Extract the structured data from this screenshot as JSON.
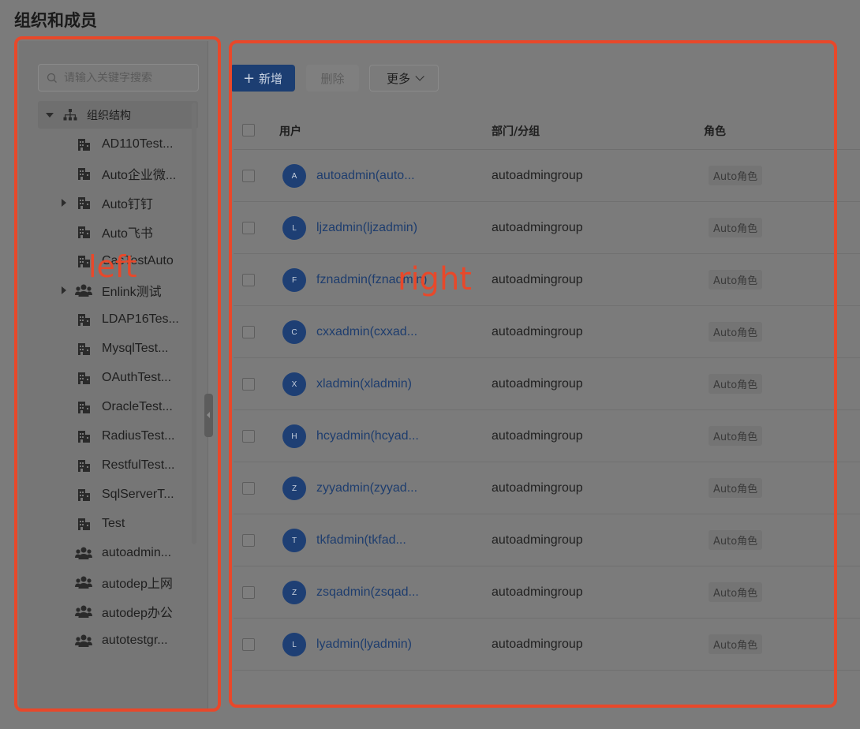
{
  "page": {
    "title": "组织和成员"
  },
  "sidebar": {
    "search_placeholder": "请输入关键字搜索",
    "root_label": "组织结构",
    "items": [
      {
        "label": "AD110Test...",
        "icon": "building-icon",
        "expandable": false
      },
      {
        "label": "Auto企业微...",
        "icon": "building-icon",
        "expandable": false
      },
      {
        "label": "Auto钉钉",
        "icon": "building-icon",
        "expandable": true
      },
      {
        "label": "Auto飞书",
        "icon": "building-icon",
        "expandable": false
      },
      {
        "label": "CasTestAuto",
        "icon": "building-icon",
        "expandable": false
      },
      {
        "label": "Enlink测试",
        "icon": "group-icon",
        "expandable": true
      },
      {
        "label": "LDAP16Tes...",
        "icon": "building-icon",
        "expandable": false
      },
      {
        "label": "MysqlTest...",
        "icon": "building-icon",
        "expandable": false
      },
      {
        "label": "OAuthTest...",
        "icon": "building-icon",
        "expandable": false
      },
      {
        "label": "OracleTest...",
        "icon": "building-icon",
        "expandable": false
      },
      {
        "label": "RadiusTest...",
        "icon": "building-icon",
        "expandable": false
      },
      {
        "label": "RestfulTest...",
        "icon": "building-icon",
        "expandable": false
      },
      {
        "label": "SqlServerT...",
        "icon": "building-icon",
        "expandable": false
      },
      {
        "label": "Test",
        "icon": "building-icon",
        "expandable": false
      },
      {
        "label": "autoadmin...",
        "icon": "group-icon",
        "expandable": false
      },
      {
        "label": "autodep上网",
        "icon": "group-icon",
        "expandable": false
      },
      {
        "label": "autodep办公",
        "icon": "group-icon",
        "expandable": false
      },
      {
        "label": "autotestgr...",
        "icon": "group-icon",
        "expandable": false
      }
    ]
  },
  "toolbar": {
    "add_label": "新增",
    "delete_label": "删除",
    "more_label": "更多"
  },
  "table": {
    "headers": {
      "user": "用户",
      "dept": "部门/分组",
      "role": "角色"
    },
    "rows": [
      {
        "initial": "A",
        "user": "autoadmin(auto...",
        "dept": "autoadmingroup",
        "role": "Auto角色"
      },
      {
        "initial": "L",
        "user": "ljzadmin(ljzadmin)",
        "dept": "autoadmingroup",
        "role": "Auto角色"
      },
      {
        "initial": "F",
        "user": "fznadmin(fznadmin)",
        "dept": "autoadmingroup",
        "role": "Auto角色"
      },
      {
        "initial": "C",
        "user": "cxxadmin(cxxad...",
        "dept": "autoadmingroup",
        "role": "Auto角色"
      },
      {
        "initial": "X",
        "user": "xladmin(xladmin)",
        "dept": "autoadmingroup",
        "role": "Auto角色"
      },
      {
        "initial": "H",
        "user": "hcyadmin(hcyad...",
        "dept": "autoadmingroup",
        "role": "Auto角色"
      },
      {
        "initial": "Z",
        "user": "zyyadmin(zyyad...",
        "dept": "autoadmingroup",
        "role": "Auto角色"
      },
      {
        "initial": "T",
        "user": "tkfadmin(tkfad...",
        "dept": "autoadmingroup",
        "role": "Auto角色"
      },
      {
        "initial": "Z",
        "user": "zsqadmin(zsqad...",
        "dept": "autoadmingroup",
        "role": "Auto角色"
      },
      {
        "initial": "L",
        "user": "lyadmin(lyadmin)",
        "dept": "autoadmingroup",
        "role": "Auto角色"
      }
    ]
  },
  "annotations": {
    "left": "left",
    "right": "right"
  },
  "colors": {
    "annotation": "#e8482a",
    "primary": "#1c3e72",
    "link": "#1e3d6e"
  }
}
